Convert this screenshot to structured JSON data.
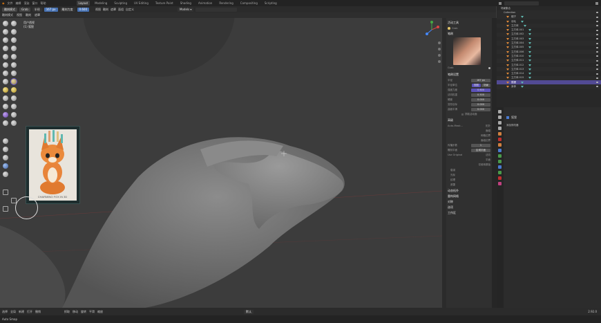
{
  "menu": [
    "文件",
    "编辑",
    "渲染",
    "窗口",
    "帮助"
  ],
  "workspaces": [
    "Layout",
    "Modeling",
    "Sculpting",
    "UV Editing",
    "Texture Paint",
    "Shading",
    "Animation",
    "Rendering",
    "Compositing",
    "Scripting"
  ],
  "active_workspace": "Layout",
  "scene": "Scene",
  "view_layer": "View Layer",
  "header": {
    "mode": "雕刻模式",
    "brush": "Grab",
    "radius_label": "半径",
    "radius": "167 px",
    "strength_label": "强度",
    "strength": "0.600",
    "strength_field": "雕刻力度",
    "menus": [
      "视图",
      "雕刻",
      "遮罩",
      "面组",
      "自定义"
    ],
    "modeler": "Models ▾"
  },
  "viewport_info": {
    "line1": "用户透视",
    "line2": "(1) 狐狸"
  },
  "npanel": {
    "active_tool_title": "活动工具",
    "tool_name": "Grab",
    "brushes_title": "笔刷",
    "brush_name": "Grab",
    "brush_settings_title": "笔刷设置",
    "radius_label": "半径",
    "radius": "167 px",
    "radius_unit_label": "半径单位",
    "unit_view": "视图",
    "unit_scene": "场景",
    "strength_label": "强度力度",
    "strength": "0.600",
    "normal_weight_label": "法向权重",
    "normal_weight": "0.500",
    "hardness_label": "硬度",
    "hardness": "0.000",
    "deform_label": "变形目标",
    "deform_value": "0.000",
    "surface_label": "曲面平滑",
    "surface_value": "0.000",
    "grab_active": "抓取活动面",
    "advanced_title": "高级",
    "automask_label": "Auto-Mask...",
    "automask_opts": [
      "拓扑",
      "面组",
      "网格边界",
      "面组边界"
    ],
    "propagate_label": "传播步数",
    "propagate_value": "1",
    "sculpt_plane_label": "雕刻平面",
    "sculpt_plane": "区域平面",
    "use_original_label": "Use Original",
    "use_original_opts": [
      "法向",
      "平面"
    ],
    "original_toggle": "仅使用原始",
    "stroke_sections": [
      "衰减",
      "光标",
      "纹理",
      "遮罩"
    ],
    "collapsed": [
      "动态拓扑",
      "重构网格",
      "对称",
      "选项",
      "工作区"
    ]
  },
  "outliner": {
    "filter_placeholder": "",
    "root": "场景集合",
    "collection": "Collection",
    "items": [
      "帽子",
      "羽毛",
      "立方体",
      "立方体.001",
      "立方体.002",
      "立方体.003",
      "立方体.004",
      "立方体.005",
      "立方体.006",
      "立方体.010",
      "立方体.011",
      "立方体.012",
      "立方体.013",
      "立方体.014",
      "立方体.015",
      "狐狸",
      "身体"
    ],
    "selected": "狐狸"
  },
  "properties": {
    "object": "狐狸",
    "section": "添加修改器"
  },
  "status": {
    "left_items": [
      "选择",
      "全局",
      "新建",
      "打开",
      "撤销"
    ],
    "mid_items": [
      "抓取",
      "移动",
      "旋转",
      "平滑",
      "缩放"
    ],
    "layer": "默认",
    "right_text": "",
    "version": "2.92.0",
    "hint": "Auto Smap"
  },
  "ref_caption": "CHARMING FOX IN 3D"
}
